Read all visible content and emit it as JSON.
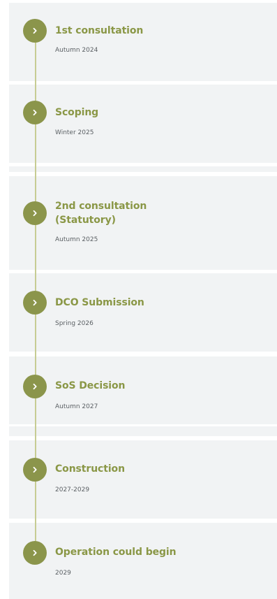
{
  "timeline": {
    "accent_color": "#8b954b",
    "line_color": "#c6cc93",
    "card_color": "#f1f3f4",
    "items": [
      {
        "title": "1st consultation",
        "date": "Autumn 2024",
        "icon": "chevron-right-icon"
      },
      {
        "title": "Scoping",
        "date": "Winter 2025",
        "icon": "chevron-right-icon"
      },
      {
        "title_line1": "2nd consultation",
        "title_line2": "(Statutory)",
        "date": "Autumn 2025",
        "icon": "chevron-right-icon"
      },
      {
        "title": "DCO Submission",
        "date": "Spring 2026",
        "icon": "chevron-right-icon"
      },
      {
        "title": "SoS Decision",
        "date": "Autumn 2027",
        "icon": "chevron-right-icon"
      },
      {
        "title": "Construction",
        "date": "2027-2029",
        "icon": "chevron-right-icon"
      },
      {
        "title": "Operation could begin",
        "date": "2029",
        "icon": "chevron-right-icon"
      }
    ]
  }
}
